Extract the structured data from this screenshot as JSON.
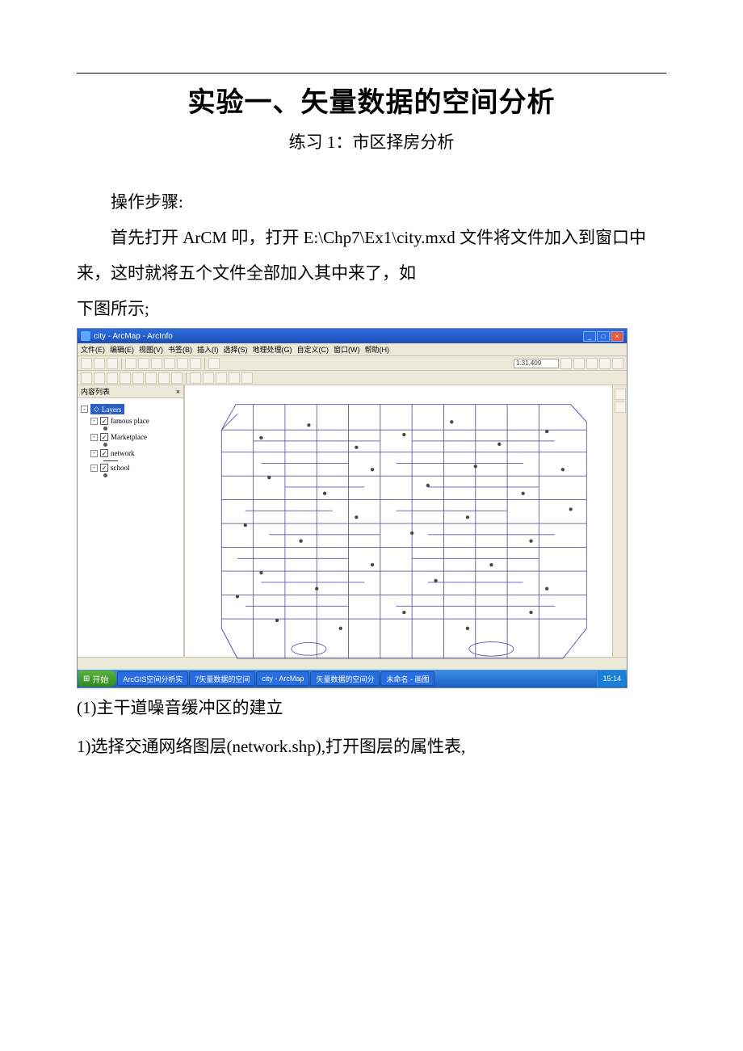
{
  "doc": {
    "title": "实验一、矢量数据的空间分析",
    "subtitle": "练习 1：市区择房分析",
    "p1": "操作步骤:",
    "p2a": "首先打开 ArCM 叩，打开 ",
    "p2_path": "E:\\Chp7\\Ex1\\city.mxd",
    "p2b": " 文件将文件加入到窗口中来，这时就将五个文件全部加入其中来了，如",
    "p3": "下图所示;",
    "caption": "(1)主干道噪音缓冲区的建立",
    "step1": "1)选择交通网络图层(network.shp),打开图层的属性表,"
  },
  "screenshot": {
    "title": "city - ArcMap - ArcInfo",
    "menus": [
      "文件(E)",
      "编辑(E)",
      "视图(V)",
      "书签(B)",
      "插入(I)",
      "选择(S)",
      "地理处理(G)",
      "自定义(C)",
      "窗口(W)",
      "帮助(H)"
    ],
    "scale_label": "1:31,409",
    "toc_header": "内容列表",
    "toc_root": "Layers",
    "layers": [
      {
        "name": "famous place",
        "type": "point"
      },
      {
        "name": "Marketplace",
        "type": "point"
      },
      {
        "name": "network",
        "type": "line"
      },
      {
        "name": "school",
        "type": "point"
      }
    ],
    "taskbar": {
      "start": "开始",
      "items": [
        "ArcGIS空间分析实",
        "7矢量数据的空间",
        "city - ArcMap",
        "矢量数据的空间分",
        "未命名 - 画图"
      ],
      "clock": "15:14"
    },
    "winbuttons": {
      "min": "_",
      "max": "□",
      "close": "×"
    }
  }
}
